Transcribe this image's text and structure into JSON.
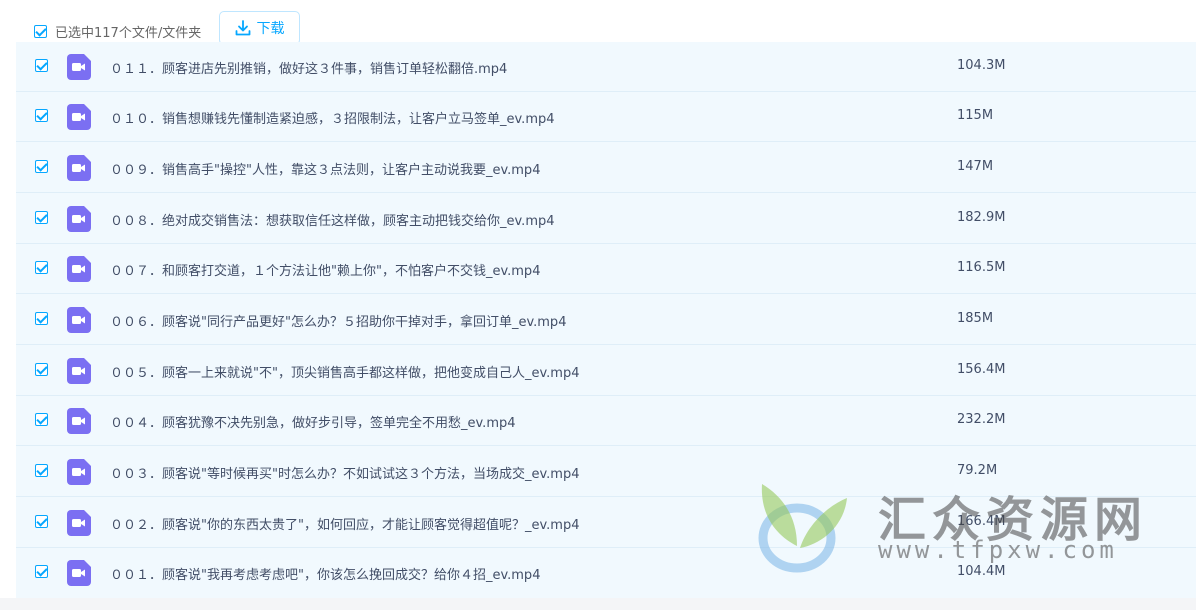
{
  "toolbar": {
    "select_all_label": "已选中117个文件/文件夹",
    "download_label": "下载"
  },
  "files": [
    {
      "name": "０１１．顾客进店先别推销，做好这３件事，销售订单轻松翻倍.mp4",
      "size": "104.3M"
    },
    {
      "name": "０１０．销售想赚钱先懂制造紧迫感，３招限制法，让客户立马签单_ev.mp4",
      "size": "115M"
    },
    {
      "name": "００９．销售高手\"操控\"人性，靠这３点法则，让客户主动说我要_ev.mp4",
      "size": "147M"
    },
    {
      "name": "００８．绝对成交销售法：想获取信任这样做，顾客主动把钱交给你_ev.mp4",
      "size": "182.9M"
    },
    {
      "name": "００７．和顾客打交道，１个方法让他\"赖上你\"，不怕客户不交钱_ev.mp4",
      "size": "116.5M"
    },
    {
      "name": "００６．顾客说\"同行产品更好\"怎么办？５招助你干掉对手，拿回订单_ev.mp4",
      "size": "185M"
    },
    {
      "name": "００５．顾客一上来就说\"不\"，顶尖销售高手都这样做，把他变成自己人_ev.mp4",
      "size": "156.4M"
    },
    {
      "name": "００４．顾客犹豫不决先别急，做好步引导，签单完全不用愁_ev.mp4",
      "size": "232.2M"
    },
    {
      "name": "００３．顾客说\"等时候再买\"时怎么办？不如试试这３个方法，当场成交_ev.mp4",
      "size": "79.2M"
    },
    {
      "name": "００２．顾客说\"你的东西太贵了\"，如何回应，才能让顾客觉得超值呢？_ev.mp4",
      "size": "166.4M"
    },
    {
      "name": "００１．顾客说\"我再考虑考虑吧\"，你该怎么挽回成交？给你４招_ev.mp4",
      "size": "104.4M"
    }
  ],
  "watermark": {
    "title": "汇众资源网",
    "url": "www.tfpxw.com"
  },
  "colors": {
    "accent": "#06a7ff",
    "video_icon": "#7b6ff2",
    "list_bg": "#f1f9fe"
  }
}
